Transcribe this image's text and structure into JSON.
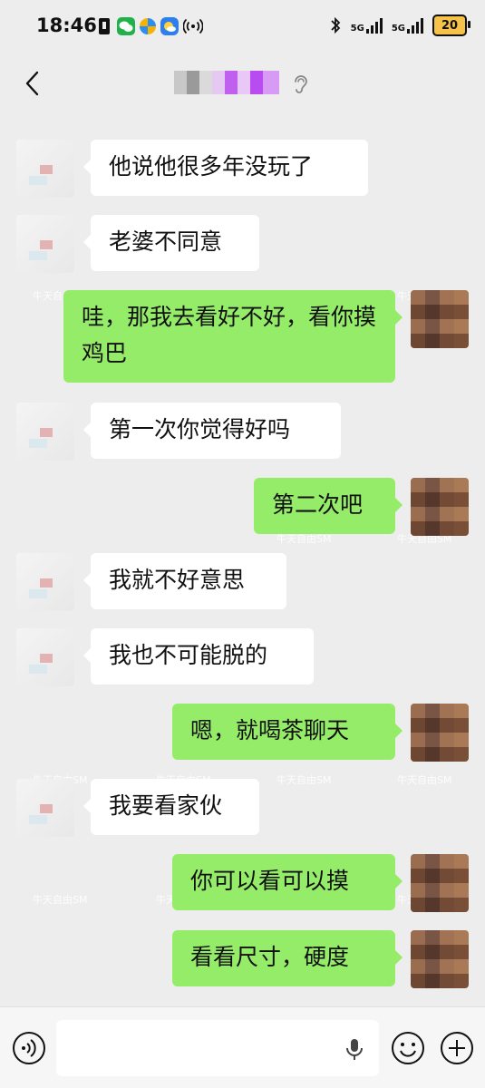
{
  "status_bar": {
    "time": "18:46",
    "network_1": "5G",
    "network_2": "5G",
    "battery": "20"
  },
  "title_bar": {
    "back_icon": "chevron-left-icon",
    "ear_icon": "ear-icon"
  },
  "messages": [
    {
      "side": "left",
      "text": "他说他很多年没玩了"
    },
    {
      "side": "left",
      "text": "老婆不同意"
    },
    {
      "side": "right",
      "text": "哇，那我去看好不好，看你摸鸡巴"
    },
    {
      "side": "left",
      "text": "第一次你觉得好吗"
    },
    {
      "side": "right",
      "text": "第二次吧"
    },
    {
      "side": "left",
      "text": "我就不好意思"
    },
    {
      "side": "left",
      "text": "我也不可能脱的"
    },
    {
      "side": "right",
      "text": "嗯，就喝茶聊天"
    },
    {
      "side": "left",
      "text": "我要看家伙"
    },
    {
      "side": "right",
      "text": "你可以看可以摸"
    },
    {
      "side": "right",
      "text": "看看尺寸，硬度"
    }
  ],
  "watermark": {
    "text": "牛天自由SM"
  },
  "input_bar": {
    "placeholder": "",
    "voice_icon": "voice-icon",
    "mic_icon": "mic-icon",
    "emoji_icon": "emoji-icon",
    "plus_icon": "plus-icon"
  },
  "colors": {
    "background": "#ededed",
    "bubble_sent": "#95ec69",
    "bubble_received": "#ffffff"
  }
}
